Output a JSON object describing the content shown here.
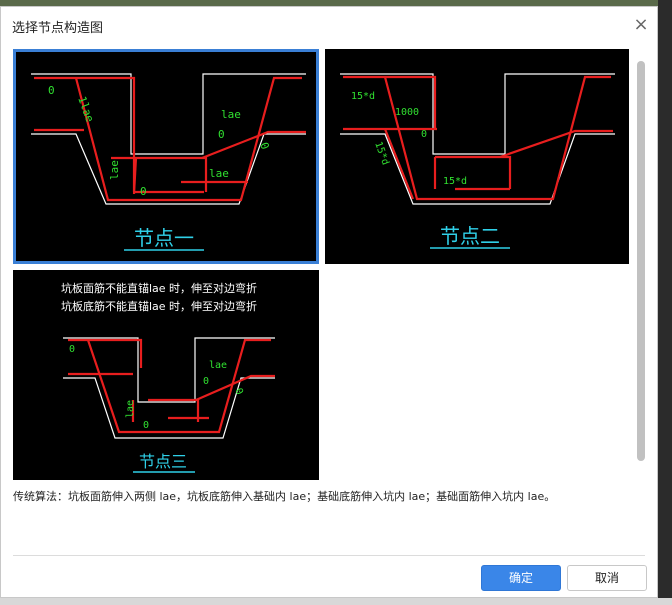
{
  "dialog": {
    "title": "选择节点构造图",
    "ok_label": "确定",
    "cancel_label": "取消",
    "description": "传统算法：坑板面筋伸入两侧 lae，坑板底筋伸入基础内 lae；基础底筋伸入坑内 lae；基础面筋伸入坑内 lae。"
  },
  "nodes": [
    {
      "caption": "节点一",
      "selected": true,
      "labels": {
        "zero_left": "0",
        "one_lae": "1lae",
        "lae_top": "lae",
        "zero_mid": "0",
        "zero_right": "0",
        "lae_side": "lae",
        "zero_bottom": "0",
        "lae_bottom": "lae"
      }
    },
    {
      "caption": "节点二",
      "selected": false,
      "labels": {
        "d15_left": "15*d",
        "dim_1000": "1000",
        "zero_mid": "0",
        "d15_side": "15*d",
        "d15_bottom": "15*d"
      }
    },
    {
      "caption": "节点三",
      "selected": false,
      "note_line1": "坑板面筋不能直锚lae 时，伸至对边弯折",
      "note_line2": "坑板底筋不能直锚lae 时，伸至对边弯折",
      "labels": {
        "zero_left": "0",
        "lae_top": "lae",
        "zero_mid": "0",
        "lae_side": "lae",
        "zero_bottom": "0",
        "zero_right": "0"
      }
    }
  ],
  "colors": {
    "accent": "#3a86e8",
    "rebar": "#e81e1e",
    "dim_text": "#30e030",
    "caption": "#2fd0e8",
    "outline": "#ffffff"
  }
}
